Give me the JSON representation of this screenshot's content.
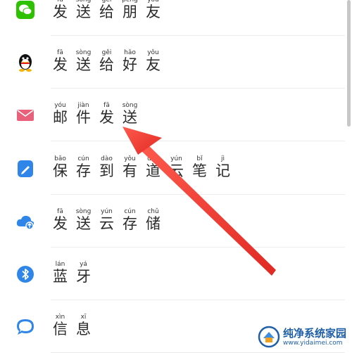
{
  "share_menu": {
    "items": [
      {
        "id": "wechat",
        "icon": "wechat-icon",
        "chars": [
          [
            "fā",
            "发"
          ],
          [
            "sòng",
            "送"
          ],
          [
            "gěi",
            "给"
          ],
          [
            "péng",
            "朋"
          ],
          [
            "yǒu",
            "友"
          ]
        ]
      },
      {
        "id": "qq",
        "icon": "qq-penguin-icon",
        "chars": [
          [
            "fā",
            "发"
          ],
          [
            "sòng",
            "送"
          ],
          [
            "gěi",
            "给"
          ],
          [
            "hǎo",
            "好"
          ],
          [
            "yǒu",
            "友"
          ]
        ]
      },
      {
        "id": "email",
        "icon": "mail-icon",
        "chars": [
          [
            "yóu",
            "邮"
          ],
          [
            "jiàn",
            "件"
          ],
          [
            "fā",
            "发"
          ],
          [
            "sòng",
            "送"
          ]
        ]
      },
      {
        "id": "youdao",
        "icon": "youdao-note-icon",
        "chars": [
          [
            "bǎo",
            "保"
          ],
          [
            "cún",
            "存"
          ],
          [
            "dào",
            "到"
          ],
          [
            "yǒu",
            "有"
          ],
          [
            "dào",
            "道"
          ],
          [
            "yún",
            "云"
          ],
          [
            "bǐ",
            "笔"
          ],
          [
            "jì",
            "记"
          ]
        ]
      },
      {
        "id": "cloud",
        "icon": "cloud-upload-icon",
        "chars": [
          [
            "fā",
            "发"
          ],
          [
            "sòng",
            "送"
          ],
          [
            "yún",
            "云"
          ],
          [
            "cún",
            "存"
          ],
          [
            "chǔ",
            "储"
          ]
        ]
      },
      {
        "id": "bluetooth",
        "icon": "bluetooth-icon",
        "chars": [
          [
            "lán",
            "蓝"
          ],
          [
            "yá",
            "牙"
          ]
        ]
      },
      {
        "id": "message",
        "icon": "message-icon",
        "chars": [
          [
            "xìn",
            "信"
          ],
          [
            "xī",
            "息"
          ]
        ]
      }
    ]
  },
  "watermark": {
    "title": "纯净系统家园",
    "url": "www.yidaimei.com"
  },
  "colors": {
    "wechat": "#2dc100",
    "mail": "#e8607a",
    "blue": "#2f86e8",
    "arrow": "#e8352f"
  }
}
